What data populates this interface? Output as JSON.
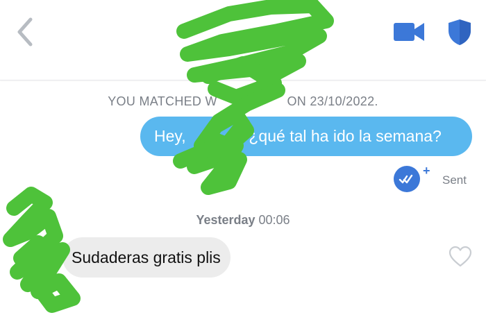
{
  "header": {
    "back_icon": "chevron-left-icon",
    "video_icon": "video-camera-icon",
    "safety_icon": "shield-icon",
    "accent_color": "#3c78d8"
  },
  "conversation": {
    "match_notice_prefix": "YOU MATCHED W",
    "match_notice_suffix": "ON 23/10/2022.",
    "sent_message": {
      "greeting": "Hey,",
      "body": "¿qué tal ha ido la semana?",
      "bubble_color": "#5ab8ef",
      "status": "Sent",
      "receipt_icon": "double-check-icon"
    },
    "timestamp": {
      "day": "Yesterday",
      "time": "00:06"
    },
    "received_message": {
      "text": "Sudaderas gratis plis",
      "bubble_color": "#ececec",
      "like_icon": "heart-icon"
    },
    "redaction_color": "#4ec23a"
  }
}
